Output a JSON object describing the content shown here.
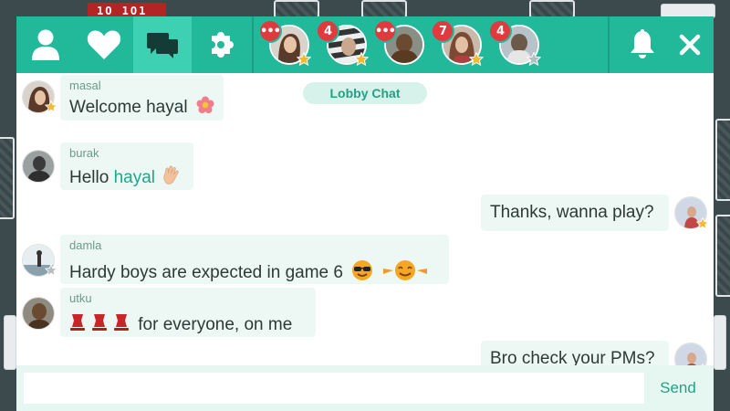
{
  "background": {
    "score_display": "1O 1O1"
  },
  "topbar": {
    "tabs": [
      {
        "name": "profile",
        "icon": "person-icon"
      },
      {
        "name": "favorites",
        "icon": "heart-icon"
      },
      {
        "name": "chat",
        "icon": "chat-bubbles-icon",
        "active": true
      },
      {
        "name": "puzzle",
        "icon": "puzzle-icon"
      }
    ],
    "conversations": [
      {
        "badge": "•••",
        "star": "gold"
      },
      {
        "badge": "4",
        "star": "gold"
      },
      {
        "badge": "•••",
        "star": "none"
      },
      {
        "badge": "7",
        "star": "gold"
      },
      {
        "badge": "4",
        "star": "gray"
      }
    ],
    "bell_icon": "bell-icon",
    "close_icon": "close-icon"
  },
  "chat": {
    "room_label": "Lobby Chat",
    "messages": [
      {
        "user": "masal",
        "text": "Welcome hayal",
        "emoji": "flower-icon",
        "side": "left"
      },
      {
        "user": "burak",
        "text_before": "Hello ",
        "mention": "hayal",
        "emoji": "waving-hand-icon",
        "side": "left"
      },
      {
        "text": "Thanks, wanna play?",
        "side": "right"
      },
      {
        "user": "damla",
        "text": "Hardy boys are expected in game 6",
        "emoji": "sunglasses-face-icon",
        "side": "left"
      },
      {
        "user": "utku",
        "text": "for everyone, on me",
        "emoji": "tea-glass-icon",
        "side": "left"
      },
      {
        "text": "Bro check your PMs?",
        "side": "right"
      }
    ]
  },
  "input": {
    "value": "",
    "placeholder": "",
    "send_label": "Send"
  },
  "colors": {
    "accent": "#21b99a",
    "accent_active": "#3ed0b2",
    "badge": "#e0393e",
    "bubble": "#edf8f4",
    "mention": "#1ea788"
  }
}
